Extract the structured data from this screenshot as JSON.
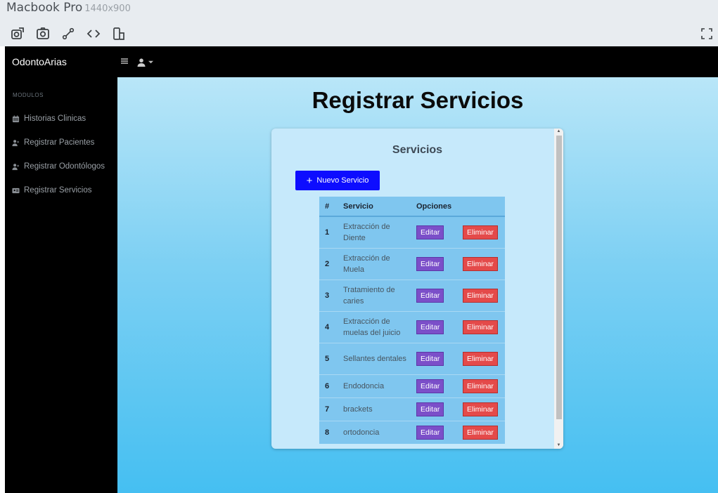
{
  "device": {
    "name": "Macbook Pro",
    "resolution": "1440x900"
  },
  "navbar": {
    "brand": "OdontoArias"
  },
  "sidebar": {
    "heading": "MODULOS",
    "items": [
      {
        "label": "Historias Clinicas",
        "icon": "calendar-icon"
      },
      {
        "label": "Registrar Pacientes",
        "icon": "user-add-icon"
      },
      {
        "label": "Registrar Odontólogos",
        "icon": "user-add-icon"
      },
      {
        "label": "Registrar Servicios",
        "icon": "id-card-icon"
      }
    ]
  },
  "main": {
    "title": "Registrar Servicios",
    "card": {
      "title": "Servicios",
      "new_button": "Nuevo Servicio",
      "table": {
        "headers": [
          "#",
          "Servicio",
          "Opciones",
          ""
        ],
        "edit_label": "Editar",
        "delete_label": "Eliminar",
        "rows": [
          {
            "num": "1",
            "service": "Extracción de Diente"
          },
          {
            "num": "2",
            "service": "Extracción de Muela"
          },
          {
            "num": "3",
            "service": "Tratamiento de caries"
          },
          {
            "num": "4",
            "service": "Extracción de muelas del juicio"
          },
          {
            "num": "5",
            "service": "Sellantes dentales"
          },
          {
            "num": "6",
            "service": "Endodoncia"
          },
          {
            "num": "7",
            "service": "brackets"
          },
          {
            "num": "8",
            "service": "ortodoncia"
          }
        ]
      }
    }
  },
  "colors": {
    "new_button": "#0d0dff",
    "edit_button": "#7b4fc9",
    "delete_button": "#e44a4a",
    "table_bg": "#7fc6ef"
  }
}
